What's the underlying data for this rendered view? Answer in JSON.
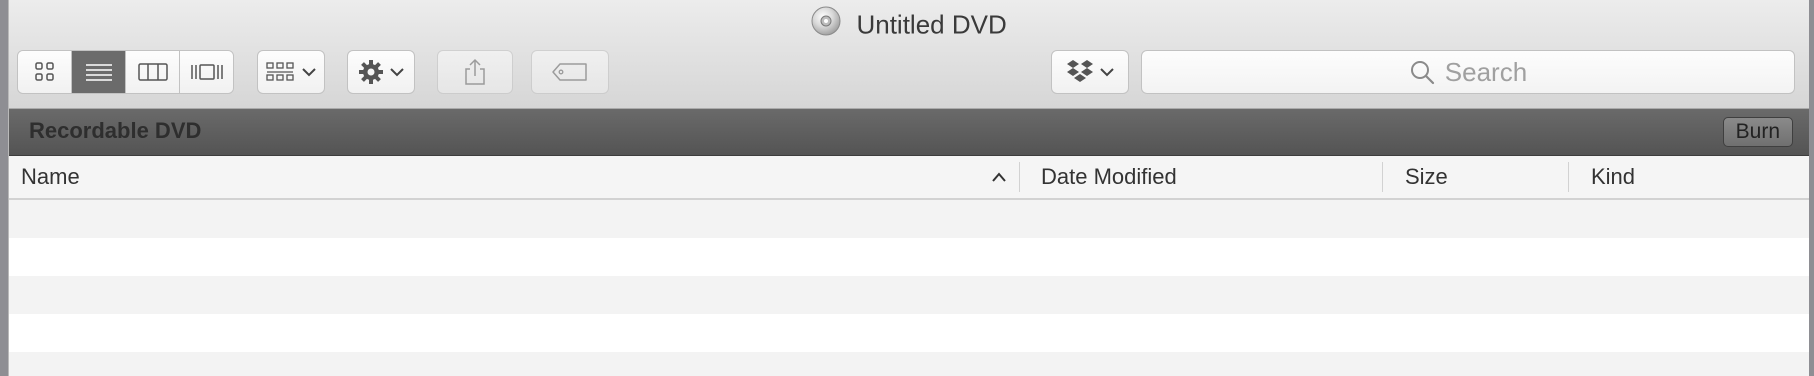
{
  "window": {
    "title": "Untitled DVD"
  },
  "toolbar": {
    "view_modes": [
      {
        "name": "icon-view",
        "active": false
      },
      {
        "name": "list-view",
        "active": true
      },
      {
        "name": "column-view",
        "active": false
      },
      {
        "name": "coverflow-view",
        "active": false
      }
    ],
    "group_button": "arrange-icon",
    "action_button": "gear-icon",
    "share_button": "share-icon",
    "tags_button": "tag-icon",
    "dropbox_button": "dropbox-icon",
    "search": {
      "placeholder": "Search"
    }
  },
  "pathbar": {
    "title": "Recordable DVD",
    "burn_label": "Burn"
  },
  "table": {
    "columns": [
      "Name",
      "Date Modified",
      "Size",
      "Kind"
    ],
    "sort_column": "Name",
    "sort_direction": "ascending",
    "rows": []
  },
  "colors": {
    "pathbar_bg": "#5c5c5c",
    "active_segment": "#6b6b6b",
    "row_alt": "#f3f3f3"
  }
}
